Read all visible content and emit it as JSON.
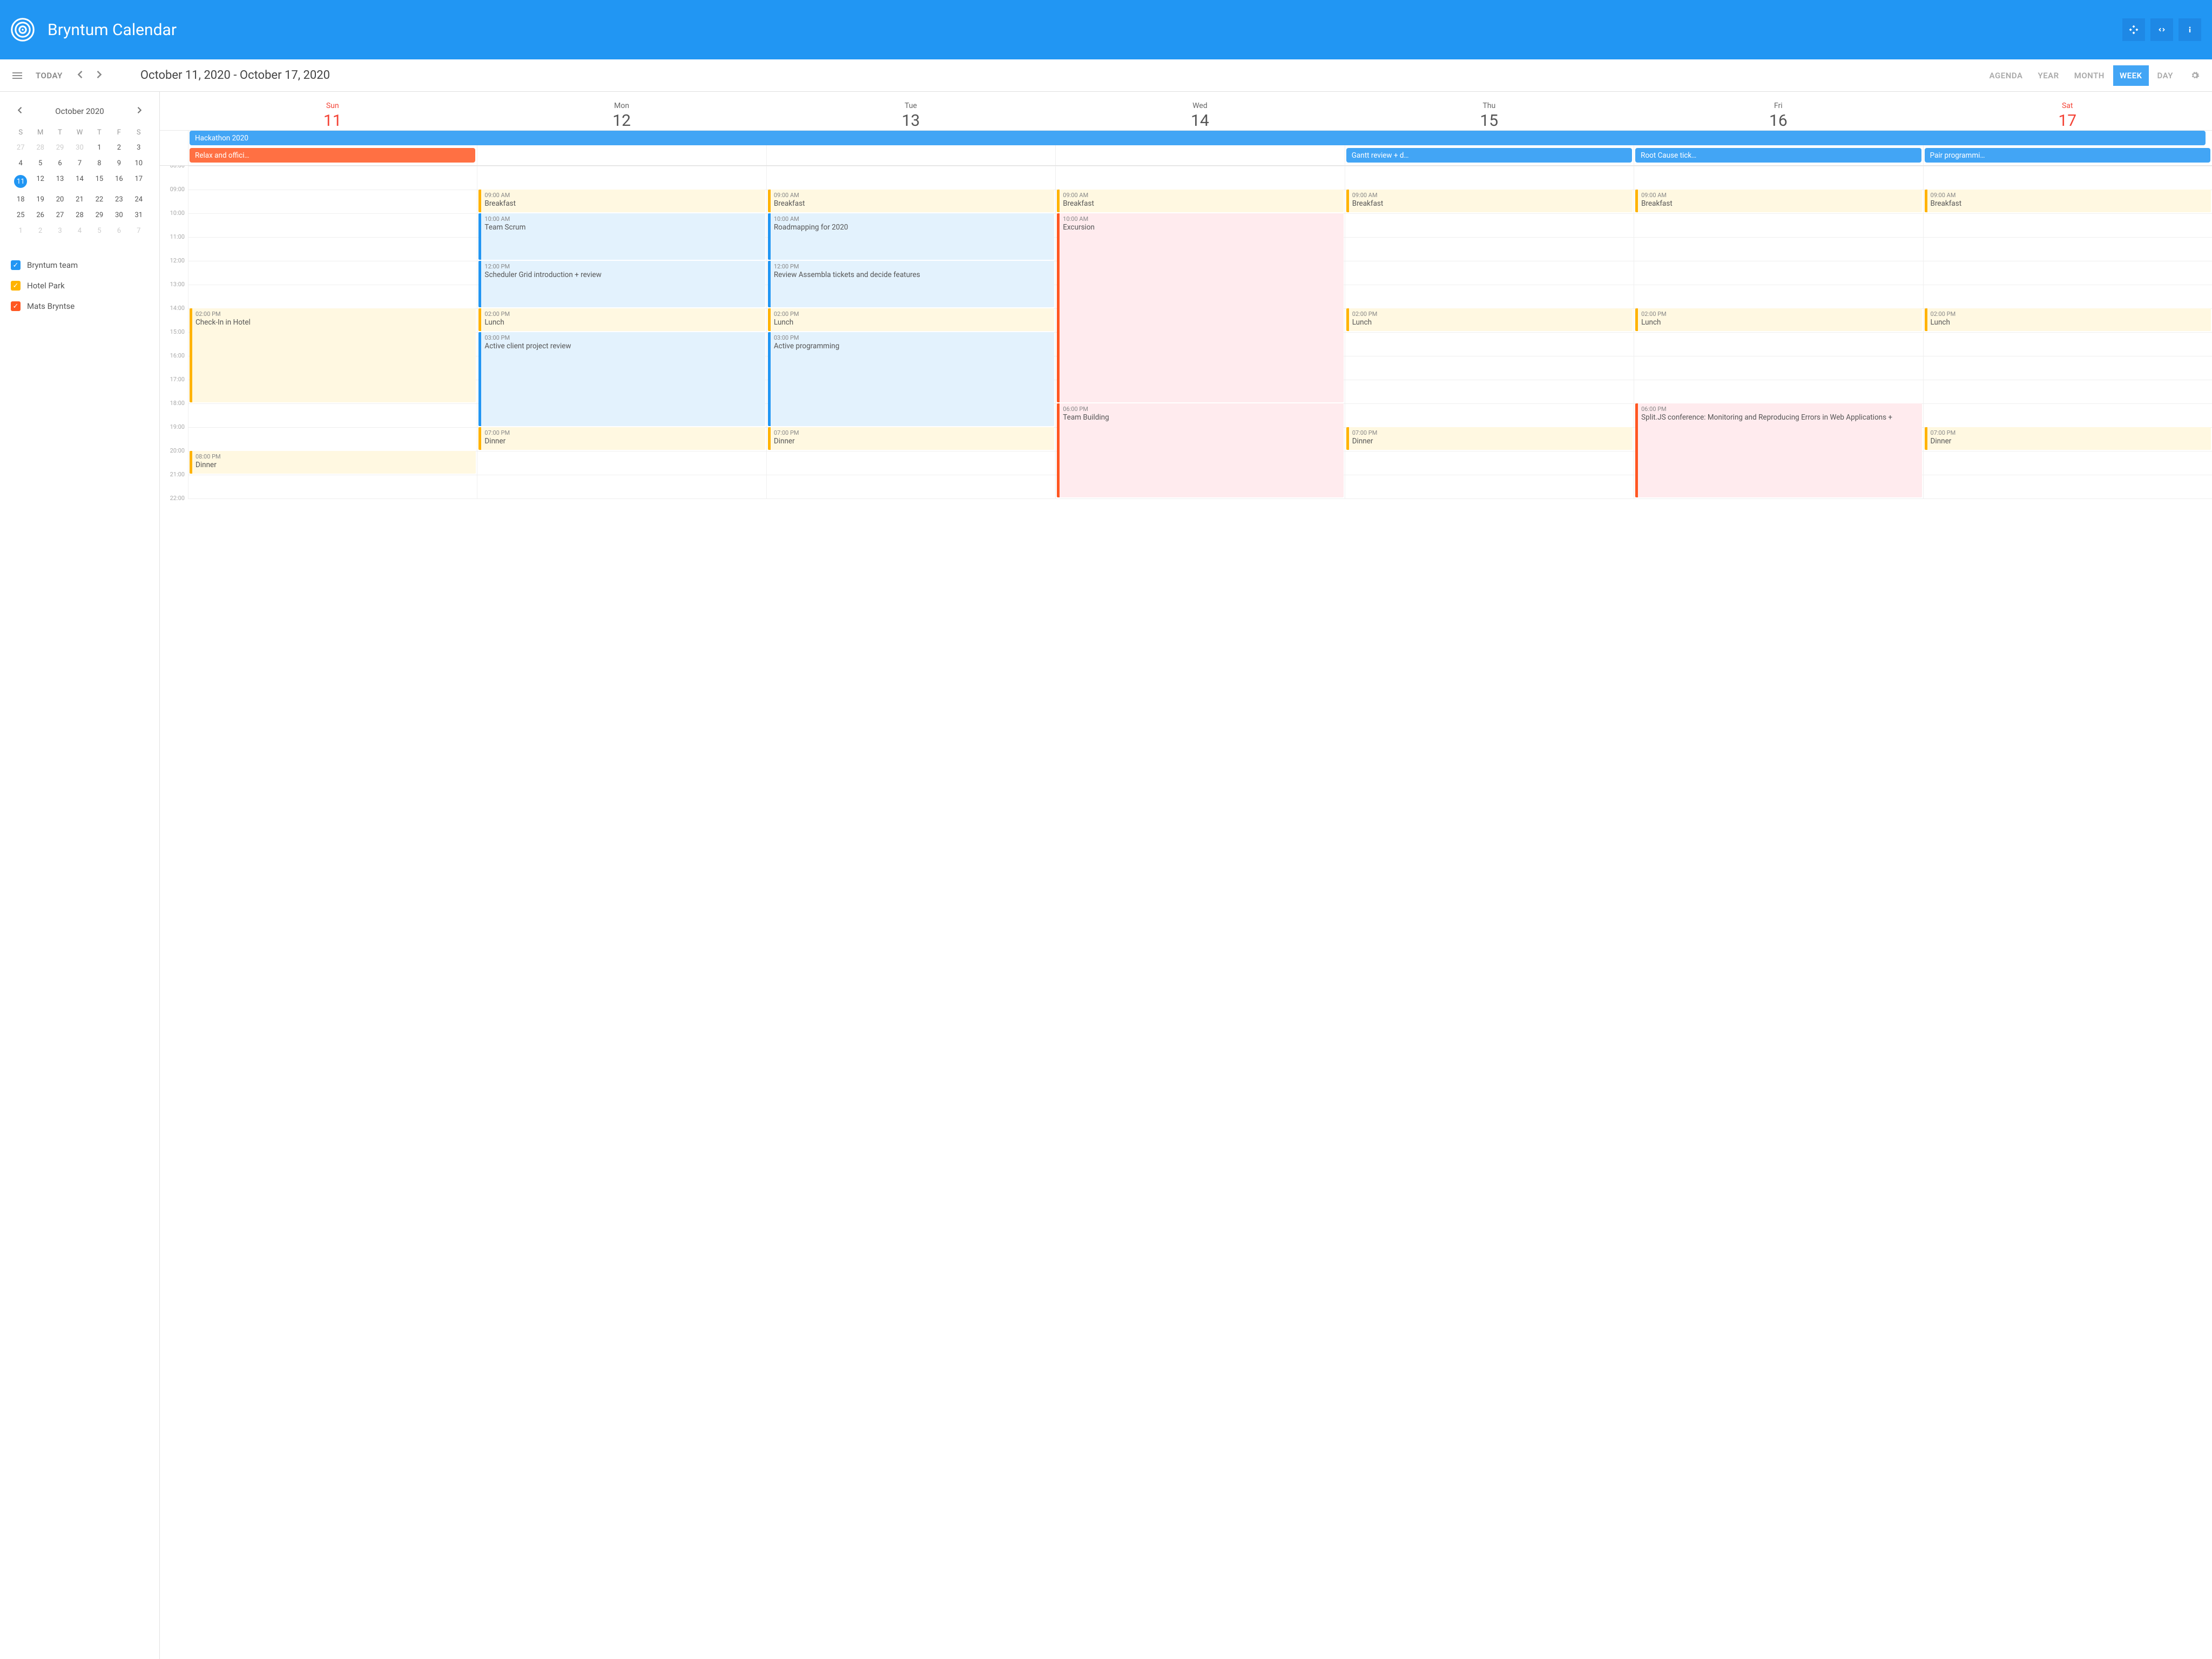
{
  "header": {
    "title": "Bryntum Calendar"
  },
  "toolbar": {
    "today": "TODAY",
    "range": "October 11, 2020 - October 17, 2020",
    "views": [
      "AGENDA",
      "YEAR",
      "MONTH",
      "WEEK",
      "DAY"
    ],
    "activeView": "WEEK"
  },
  "miniCal": {
    "title": "October  2020",
    "dow": [
      "S",
      "M",
      "T",
      "W",
      "T",
      "F",
      "S"
    ],
    "days": [
      {
        "n": 27,
        "other": true
      },
      {
        "n": 28,
        "other": true
      },
      {
        "n": 29,
        "other": true
      },
      {
        "n": 30,
        "other": true
      },
      {
        "n": 1
      },
      {
        "n": 2
      },
      {
        "n": 3
      },
      {
        "n": 4
      },
      {
        "n": 5
      },
      {
        "n": 6
      },
      {
        "n": 7
      },
      {
        "n": 8
      },
      {
        "n": 9
      },
      {
        "n": 10
      },
      {
        "n": 11,
        "today": true
      },
      {
        "n": 12
      },
      {
        "n": 13
      },
      {
        "n": 14
      },
      {
        "n": 15
      },
      {
        "n": 16
      },
      {
        "n": 17
      },
      {
        "n": 18
      },
      {
        "n": 19
      },
      {
        "n": 20
      },
      {
        "n": 21
      },
      {
        "n": 22
      },
      {
        "n": 23
      },
      {
        "n": 24
      },
      {
        "n": 25
      },
      {
        "n": 26
      },
      {
        "n": 27
      },
      {
        "n": 28
      },
      {
        "n": 29
      },
      {
        "n": 30
      },
      {
        "n": 31
      },
      {
        "n": 1,
        "other": true
      },
      {
        "n": 2,
        "other": true
      },
      {
        "n": 3,
        "other": true
      },
      {
        "n": 4,
        "other": true
      },
      {
        "n": 5,
        "other": true
      },
      {
        "n": 6,
        "other": true
      },
      {
        "n": 7,
        "other": true
      }
    ]
  },
  "resources": [
    {
      "label": "Bryntum team",
      "color": "#2196f3"
    },
    {
      "label": "Hotel Park",
      "color": "#ffb300"
    },
    {
      "label": "Mats Bryntse",
      "color": "#ff5722"
    }
  ],
  "days": [
    {
      "dow": "Sun",
      "num": "11",
      "weekend": true
    },
    {
      "dow": "Mon",
      "num": "12"
    },
    {
      "dow": "Tue",
      "num": "13"
    },
    {
      "dow": "Wed",
      "num": "14"
    },
    {
      "dow": "Thu",
      "num": "15"
    },
    {
      "dow": "Fri",
      "num": "16"
    },
    {
      "dow": "Sat",
      "num": "17",
      "weekend": true
    }
  ],
  "alldayRows": [
    [
      {
        "label": "Hackathon 2020",
        "color": "#42a5f5",
        "startCol": 0,
        "span": 7,
        "arrow": true
      }
    ],
    [
      {
        "label": "Relax and offici…",
        "color": "#ff7043",
        "startCol": 0,
        "span": 1
      },
      {
        "label": "Gantt review + d…",
        "color": "#42a5f5",
        "startCol": 4,
        "span": 1
      },
      {
        "label": "Root Cause tick…",
        "color": "#42a5f5",
        "startCol": 5,
        "span": 1
      },
      {
        "label": "Pair programmi…",
        "color": "#42a5f5",
        "startCol": 6,
        "span": 1
      }
    ]
  ],
  "hourStart": 8,
  "hourEnd": 22,
  "hourPx": 44,
  "events": {
    "0": [
      {
        "time": "02:00 PM",
        "title": "Check-In in Hotel",
        "start": 14,
        "end": 18,
        "color": "#ffb300",
        "bg": "#fff8e1"
      },
      {
        "time": "08:00 PM",
        "title": "Dinner",
        "start": 20,
        "end": 21,
        "color": "#ffb300",
        "bg": "#fff8e1"
      }
    ],
    "1": [
      {
        "time": "09:00 AM",
        "title": "Breakfast",
        "start": 9,
        "end": 10,
        "color": "#ffb300",
        "bg": "#fff8e1"
      },
      {
        "time": "10:00 AM",
        "title": "Team Scrum",
        "start": 10,
        "end": 12,
        "color": "#2196f3",
        "bg": "#e3f2fd"
      },
      {
        "time": "12:00 PM",
        "title": "Scheduler Grid introduction + review",
        "start": 12,
        "end": 14,
        "color": "#2196f3",
        "bg": "#e3f2fd"
      },
      {
        "time": "02:00 PM",
        "title": "Lunch",
        "start": 14,
        "end": 15,
        "color": "#ffb300",
        "bg": "#fff8e1"
      },
      {
        "time": "03:00 PM",
        "title": "Active client project review",
        "start": 15,
        "end": 19,
        "color": "#2196f3",
        "bg": "#e3f2fd"
      },
      {
        "time": "07:00 PM",
        "title": "Dinner",
        "start": 19,
        "end": 20,
        "color": "#ffb300",
        "bg": "#fff8e1"
      }
    ],
    "2": [
      {
        "time": "09:00 AM",
        "title": "Breakfast",
        "start": 9,
        "end": 10,
        "color": "#ffb300",
        "bg": "#fff8e1"
      },
      {
        "time": "10:00 AM",
        "title": "Roadmapping for 2020",
        "start": 10,
        "end": 12,
        "color": "#2196f3",
        "bg": "#e3f2fd"
      },
      {
        "time": "12:00 PM",
        "title": "Review Assembla tickets and decide features",
        "start": 12,
        "end": 14,
        "color": "#2196f3",
        "bg": "#e3f2fd"
      },
      {
        "time": "02:00 PM",
        "title": "Lunch",
        "start": 14,
        "end": 15,
        "color": "#ffb300",
        "bg": "#fff8e1"
      },
      {
        "time": "03:00 PM",
        "title": "Active programming",
        "start": 15,
        "end": 19,
        "color": "#2196f3",
        "bg": "#e3f2fd"
      },
      {
        "time": "07:00 PM",
        "title": "Dinner",
        "start": 19,
        "end": 20,
        "color": "#ffb300",
        "bg": "#fff8e1"
      }
    ],
    "3": [
      {
        "time": "09:00 AM",
        "title": "Breakfast",
        "start": 9,
        "end": 10,
        "color": "#ffb300",
        "bg": "#fff8e1"
      },
      {
        "time": "10:00 AM",
        "title": "Excursion",
        "start": 10,
        "end": 18,
        "color": "#ff5722",
        "bg": "#ffebee"
      },
      {
        "time": "06:00 PM",
        "title": "Team Building",
        "start": 18,
        "end": 22,
        "color": "#ff5722",
        "bg": "#ffebee"
      }
    ],
    "4": [
      {
        "time": "09:00 AM",
        "title": "Breakfast",
        "start": 9,
        "end": 10,
        "color": "#ffb300",
        "bg": "#fff8e1"
      },
      {
        "time": "02:00 PM",
        "title": "Lunch",
        "start": 14,
        "end": 15,
        "color": "#ffb300",
        "bg": "#fff8e1"
      },
      {
        "time": "07:00 PM",
        "title": "Dinner",
        "start": 19,
        "end": 20,
        "color": "#ffb300",
        "bg": "#fff8e1"
      }
    ],
    "5": [
      {
        "time": "09:00 AM",
        "title": "Breakfast",
        "start": 9,
        "end": 10,
        "color": "#ffb300",
        "bg": "#fff8e1"
      },
      {
        "time": "02:00 PM",
        "title": "Lunch",
        "start": 14,
        "end": 15,
        "color": "#ffb300",
        "bg": "#fff8e1"
      },
      {
        "time": "06:00 PM",
        "title": "Split.JS conference: Monitoring and Reproducing Errors in Web Applications +",
        "start": 18,
        "end": 22,
        "color": "#ff5722",
        "bg": "#ffebee"
      }
    ],
    "6": [
      {
        "time": "09:00 AM",
        "title": "Breakfast",
        "start": 9,
        "end": 10,
        "color": "#ffb300",
        "bg": "#fff8e1"
      },
      {
        "time": "02:00 PM",
        "title": "Lunch",
        "start": 14,
        "end": 15,
        "color": "#ffb300",
        "bg": "#fff8e1"
      },
      {
        "time": "07:00 PM",
        "title": "Dinner",
        "start": 19,
        "end": 20,
        "color": "#ffb300",
        "bg": "#fff8e1"
      }
    ]
  }
}
